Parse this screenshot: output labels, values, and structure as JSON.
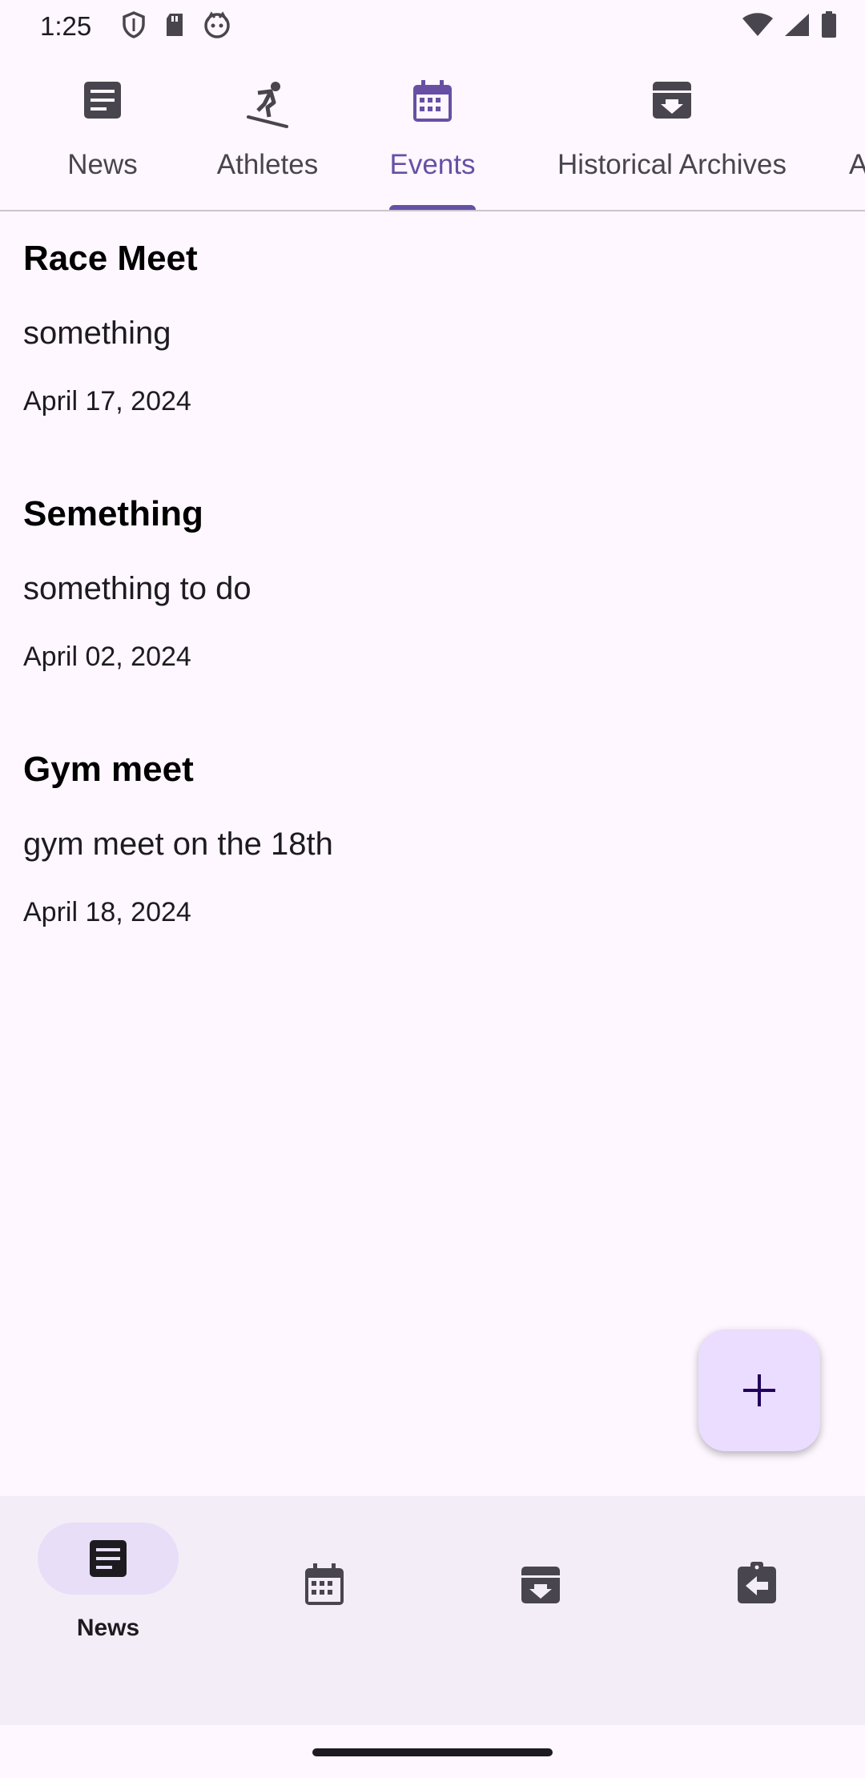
{
  "status_bar": {
    "time": "1:25",
    "left_icons": [
      "shield-icon",
      "sd-card-icon",
      "face-icon"
    ],
    "right_icons": [
      "wifi-icon",
      "cellular-signal-icon",
      "battery-icon"
    ]
  },
  "top_tabs": [
    {
      "label": "News",
      "icon": "article-icon",
      "active": false
    },
    {
      "label": "Athletes",
      "icon": "snowboarder-icon",
      "active": false
    },
    {
      "label": "Events",
      "icon": "calendar-icon",
      "active": true
    },
    {
      "label": "Historical Archives",
      "icon": "archive-icon",
      "active": false
    },
    {
      "label": "A",
      "icon": "",
      "active": false
    }
  ],
  "events": [
    {
      "title": "Race Meet",
      "description": "something",
      "date": "April 17, 2024"
    },
    {
      "title": "Semething",
      "description": "something to do",
      "date": "April 02, 2024"
    },
    {
      "title": "Gym meet",
      "description": "gym meet on the 18th",
      "date": "April 18, 2024"
    }
  ],
  "fab": {
    "icon": "plus-icon"
  },
  "bottom_nav": [
    {
      "label": "News",
      "icon": "article-icon",
      "selected": true
    },
    {
      "label": "",
      "icon": "calendar-icon",
      "selected": false
    },
    {
      "label": "",
      "icon": "archive-icon",
      "selected": false
    },
    {
      "label": "",
      "icon": "assignment-return-icon",
      "selected": false
    }
  ],
  "colors": {
    "background": "#FEF7FF",
    "accent": "#6750A4",
    "fab_container": "#EADDFF",
    "nav_background": "#F3EDF7",
    "nav_indicator": "#E8DEF8"
  }
}
